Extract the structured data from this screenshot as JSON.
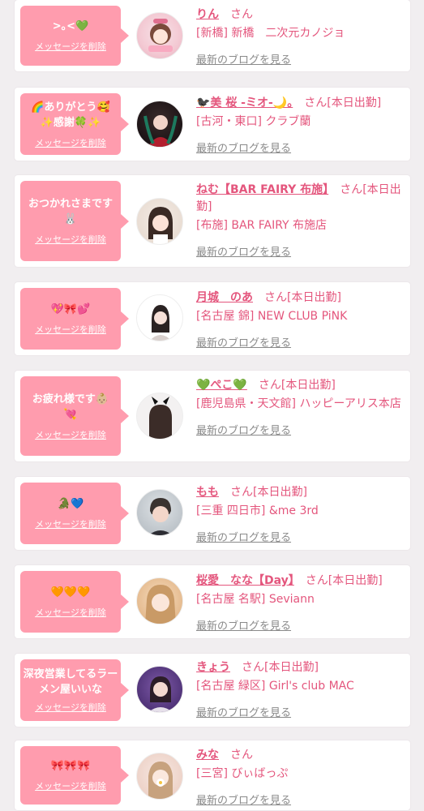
{
  "delete_label": "メッセージを削除",
  "blog_label": "最新のブログを見る",
  "san": "さん",
  "colors": {
    "accent": "#ff9cae",
    "name": "#e4567d",
    "background": "#f1eef0"
  },
  "cards": [
    {
      "message": ">｡<💚",
      "name": "りん",
      "work": "",
      "shop": "[新橋] 新橋　二次元カノジョ"
    },
    {
      "message": "🌈ありがとう🥰✨感謝🍀✨",
      "name": "🐦‍⬛美 桜 -ミオ-🌙。",
      "work": "[本日出勤]",
      "shop": "[古河・東口] クラブ蘭"
    },
    {
      "message": "おつかれさまです🐰",
      "name": "ねむ【BAR FAIRY 布施】",
      "work": "[本日出勤]",
      "shop": "[布施] BAR FAIRY 布施店"
    },
    {
      "message": "💖🎀💕",
      "name": "月城　のあ",
      "work": "[本日出勤]",
      "shop": "[名古屋 錦] NEW CLUB PiNK"
    },
    {
      "message": "お疲れ様です👶🏼💘",
      "name": "💚ぺこ💚",
      "work": "[本日出勤]",
      "shop": "[鹿児島県・天文館] ハッピーアリス本店"
    },
    {
      "message": "🐊💙",
      "name": "もも",
      "work": "[本日出勤]",
      "shop": "[三重 四日市] &me 3rd"
    },
    {
      "message": "🧡🧡🧡",
      "name": "桜愛　なな【Day】",
      "work": "[本日出勤]",
      "shop": "[名古屋 名駅] Seviann"
    },
    {
      "message": "深夜営業してるラーメン屋いいな",
      "name": "きょう",
      "work": "[本日出勤]",
      "shop": "[名古屋 緑区] Girl's club MAC"
    },
    {
      "message": "🎀🎀🎀",
      "name": "みな",
      "work": "",
      "shop": "[三宮] びぃばっぷ"
    }
  ]
}
